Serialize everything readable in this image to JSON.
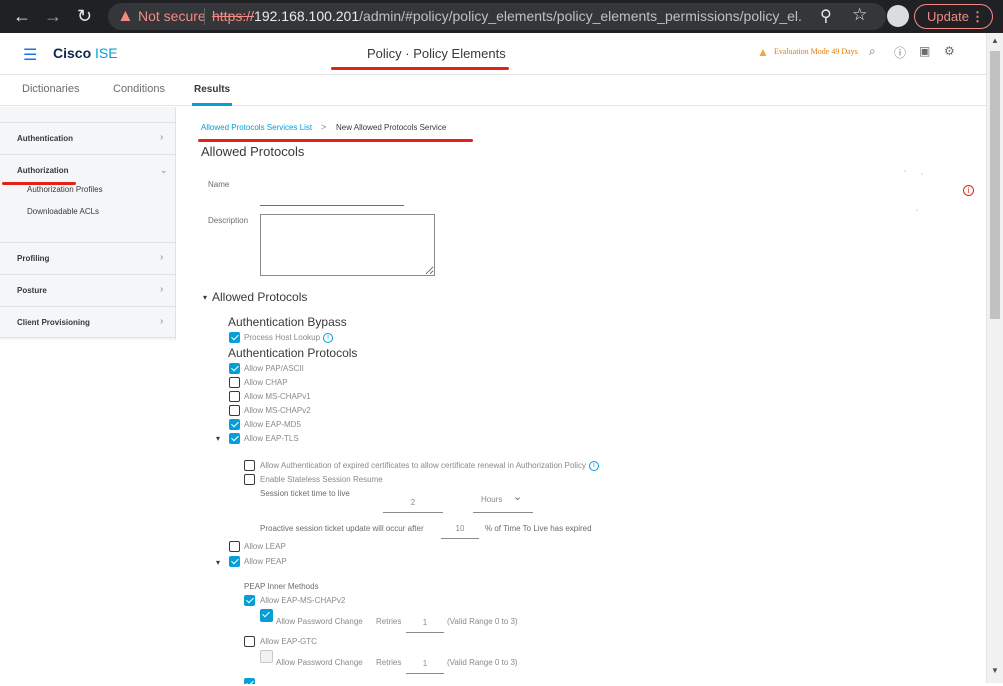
{
  "browser": {
    "warning_text": "Not secure",
    "url_scheme": "https://",
    "url_host": "192.168.100.201",
    "url_path": "/admin/#policy/policy_elements/policy_elements_permissions/policy_el...",
    "update_label": "Update"
  },
  "header": {
    "brand_cisco": "Cisco",
    "brand_ise": " ISE",
    "page_title": "Policy · Policy Elements",
    "evaluation": "Evaluation Mode 49 Days"
  },
  "tabs": [
    "Dictionaries",
    "Conditions",
    "Results"
  ],
  "sidebar": {
    "items": [
      {
        "label": "Authentication"
      },
      {
        "label": "Authorization",
        "children": [
          "Authorization Profiles",
          "Downloadable ACLs"
        ]
      },
      {
        "label": "Profiling"
      },
      {
        "label": "Posture"
      },
      {
        "label": "Client Provisioning"
      }
    ]
  },
  "main": {
    "breadcrumb_link": "Allowed Protocols Services List",
    "breadcrumb_sep": ">",
    "breadcrumb_current": "New Allowed Protocols Service",
    "title": "Allowed Protocols",
    "name_label": "Name",
    "description_label": "Description",
    "allowed_protocols_heading": "Allowed Protocols",
    "auth_bypass_heading": "Authentication Bypass",
    "process_host_lookup": {
      "label": "Process Host Lookup",
      "checked": true
    },
    "auth_protocols_heading": "Authentication Protocols",
    "protocols": [
      {
        "label": "Allow PAP/ASCII",
        "checked": true
      },
      {
        "label": "Allow CHAP",
        "checked": false
      },
      {
        "label": "Allow MS-CHAPv1",
        "checked": false
      },
      {
        "label": "Allow MS-CHAPv2",
        "checked": false
      },
      {
        "label": "Allow EAP-MD5",
        "checked": true
      },
      {
        "label": "Allow EAP-TLS",
        "checked": true
      }
    ],
    "eap_tls": {
      "expired_certs": "Allow Authentication of expired certificates to allow certificate renewal in Authorization Policy",
      "stateless_resume": "Enable Stateless Session Resume",
      "ticket_ttl_label": "Session ticket time to live",
      "ticket_ttl_value": "2",
      "ticket_ttl_unit": "Hours",
      "proactive_prefix": "Proactive session ticket update will occur after",
      "proactive_value": "10",
      "proactive_suffix": "% of Time To Live has expired"
    },
    "leap": {
      "label": "Allow LEAP",
      "checked": false
    },
    "peap": {
      "label": "Allow PEAP",
      "checked": true
    },
    "peap_inner": {
      "heading": "PEAP Inner Methods",
      "mschapv2": "Allow EAP-MS-CHAPv2",
      "mschapv2_pwd": "Allow Password Change",
      "mschapv2_retries_label": "Retries",
      "mschapv2_retries": "1",
      "mschapv2_range": "(Valid Range 0 to 3)",
      "gtc": "Allow EAP-GTC",
      "gtc_pwd": "Allow Password Change",
      "gtc_retries_label": "Retries",
      "gtc_retries": "1",
      "gtc_range": "(Valid Range 0 to 3)"
    }
  },
  "colors": {
    "accent": "#049fd9",
    "annotation": "#e2231a",
    "warning": "#f2a541"
  }
}
